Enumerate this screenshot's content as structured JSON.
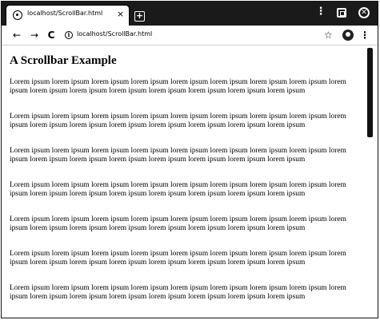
{
  "browser": {
    "tab": {
      "title": "localhost/ScrollBar.html",
      "close_glyph": "×",
      "favicon": "globe-icon"
    },
    "new_tab_glyph": "+",
    "window_controls": {
      "menu_glyph": "⋮",
      "close_glyph": "✕"
    },
    "toolbar": {
      "back_glyph": "←",
      "forward_glyph": "→",
      "reload_glyph": "C",
      "info_glyph": "i",
      "url": "localhost/ScrollBar.html",
      "star_glyph": "☆",
      "menu_glyph": "⋮"
    }
  },
  "page": {
    "heading": "A Scrollbar Example",
    "paragraphs": [
      "Lorem ipsum lorem ipsum lorem ipsum lorem ipsum lorem ipsum lorem ipsum lorem ipsum lorem ipsum lorem ipsum lorem ipsum lorem ipsum lorem ipsum lorem ipsum lorem ipsum lorem ipsum lorem ipsum",
      "Lorem ipsum lorem ipsum lorem ipsum lorem ipsum lorem ipsum lorem ipsum lorem ipsum lorem ipsum lorem ipsum lorem ipsum lorem ipsum lorem ipsum lorem ipsum lorem ipsum lorem ipsum lorem ipsum",
      "Lorem ipsum lorem ipsum lorem ipsum lorem ipsum lorem ipsum lorem ipsum lorem ipsum lorem ipsum lorem ipsum lorem ipsum lorem ipsum lorem ipsum lorem ipsum lorem ipsum lorem ipsum lorem ipsum",
      "Lorem ipsum lorem ipsum lorem ipsum lorem ipsum lorem ipsum lorem ipsum lorem ipsum lorem ipsum lorem ipsum lorem ipsum lorem ipsum lorem ipsum lorem ipsum lorem ipsum lorem ipsum lorem ipsum",
      "Lorem ipsum lorem ipsum lorem ipsum lorem ipsum lorem ipsum lorem ipsum lorem ipsum lorem ipsum lorem ipsum lorem ipsum lorem ipsum lorem ipsum lorem ipsum lorem ipsum lorem ipsum lorem ipsum",
      "Lorem ipsum lorem ipsum lorem ipsum lorem ipsum lorem ipsum lorem ipsum lorem ipsum lorem ipsum lorem ipsum lorem ipsum lorem ipsum lorem ipsum lorem ipsum lorem ipsum lorem ipsum lorem ipsum",
      "Lorem ipsum lorem ipsum lorem ipsum lorem ipsum lorem ipsum lorem ipsum lorem ipsum lorem ipsum lorem ipsum lorem ipsum lorem ipsum lorem ipsum lorem ipsum lorem ipsum lorem ipsum lorem ipsum"
    ]
  },
  "colors": {
    "tabstrip": "#1a1a1a",
    "scroll_thumb": "#111111"
  }
}
